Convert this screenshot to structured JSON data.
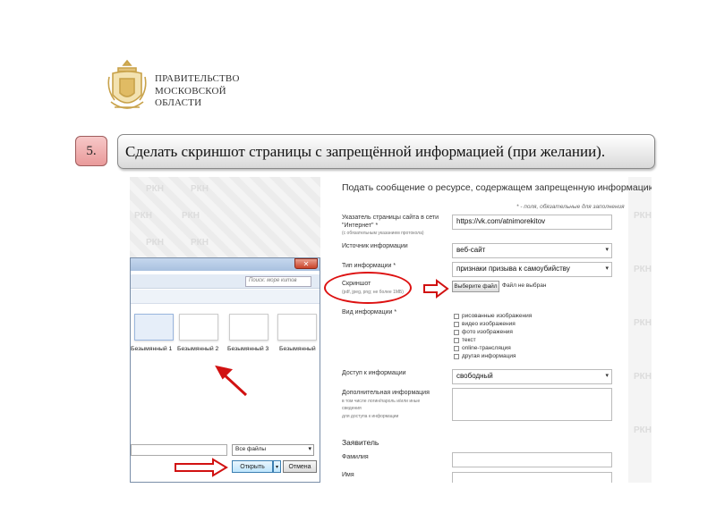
{
  "header": {
    "org_line1": "ПРАВИТЕЛЬСТВО",
    "org_line2": "МОСКОВСКОЙ",
    "org_line3": "ОБЛАСТИ"
  },
  "step": {
    "number": "5.",
    "text": "Сделать скриншот страницы с запрещённой информацией (при  желании)."
  },
  "watermark": "РКН",
  "form": {
    "title": "Подать сообщение о ресурсе, содержащем запрещенную информацию",
    "required_note": "* - поля, обязательные для заполнения",
    "url_label": "Указатель страницы сайта в сети \"Интернет\" *",
    "url_sub": "(с обязательным указанием протокола)",
    "url_value": "https://vk.com/atnimorekitov",
    "source_label": "Источник информации",
    "source_value": "веб-сайт",
    "type_label": "Тип информации *",
    "type_value": "признаки призыва к самоубийству",
    "screenshot_label": "Скриншот",
    "screenshot_sub": "(pdf, jpeg, png; не более 1МБ)",
    "file_button": "Выберите файл",
    "file_none": "Файл не выбран",
    "kind_label": "Вид информации *",
    "kinds": [
      "рисованные изображения",
      "видео изображения",
      "фото изображения",
      "текст",
      "online-трансляция",
      "другая информация"
    ],
    "access_label": "Доступ к информации",
    "access_value": "свободный",
    "extra_label": "Дополнительная информация",
    "extra_sub1": "в том числе логин/пароль и/или иные",
    "extra_sub2": "сведения",
    "extra_sub3": "для доступа к информации",
    "applicant_title": "Заявитель",
    "surname_label": "Фамилия",
    "name_label": "Имя"
  },
  "dialog": {
    "search_placeholder": "Поиск: море китов",
    "files": [
      "Безымянный 1",
      "Безымянный 2",
      "Безымянный 3",
      "Безымянный"
    ],
    "filter_value": "Все файлы",
    "open_button": "Открыть",
    "cancel_button": "Отмена",
    "close_symbol": "✕"
  },
  "colors": {
    "annotation_red": "#d11111",
    "step_badge": "#e99a9a"
  }
}
